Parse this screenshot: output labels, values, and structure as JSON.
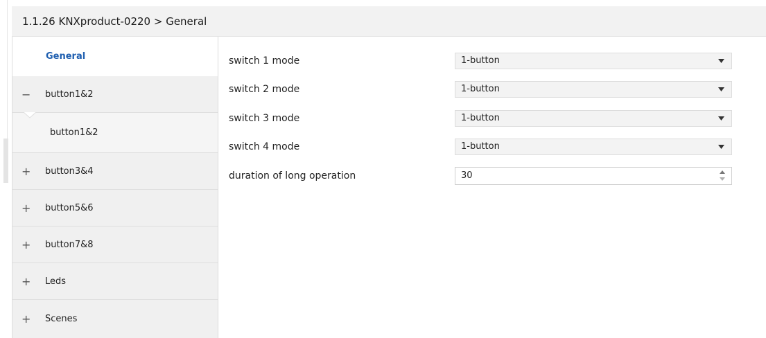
{
  "header": {
    "title": "1.1.26 KNXproduct-0220 > General"
  },
  "sidebar": {
    "general": {
      "label": "General"
    },
    "groups": [
      {
        "sign": "−",
        "label": "button1&2"
      },
      {
        "sign": "+",
        "label": "button3&4"
      },
      {
        "sign": "+",
        "label": "button5&6"
      },
      {
        "sign": "+",
        "label": "button7&8"
      },
      {
        "sign": "+",
        "label": "Leds"
      },
      {
        "sign": "+",
        "label": "Scenes"
      }
    ],
    "sub_items": [
      {
        "label": "button1&2"
      }
    ]
  },
  "params": [
    {
      "label": "switch 1 mode",
      "value": "1-button",
      "kind": "dropdown"
    },
    {
      "label": "switch 2 mode",
      "value": "1-button",
      "kind": "dropdown"
    },
    {
      "label": "switch 3 mode",
      "value": "1-button",
      "kind": "dropdown"
    },
    {
      "label": "switch 4 mode",
      "value": "1-button",
      "kind": "dropdown"
    },
    {
      "label": "duration of long operation",
      "value": "30",
      "kind": "number"
    }
  ],
  "colors": {
    "accent": "#1f5fb0",
    "header_bg": "#f2f2f2",
    "sidebar_bg": "#f0f0f0",
    "field_bg": "#f3f3f3"
  },
  "icons": {
    "dropdown": "caret-down-icon",
    "spinner": "spin-arrows-icon",
    "collapse": "minus-icon",
    "expand": "plus-icon"
  }
}
